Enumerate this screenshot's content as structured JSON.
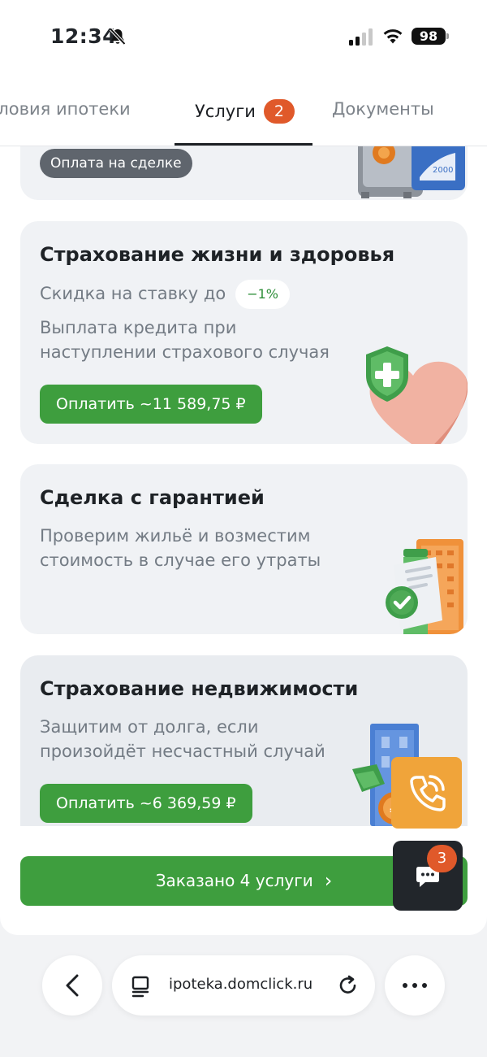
{
  "status_bar": {
    "time": "12:34",
    "battery": "98"
  },
  "tabs": [
    {
      "label": "Условия ипотеки"
    },
    {
      "label": "Услуги",
      "badge": "2"
    },
    {
      "label": "Документы"
    }
  ],
  "cards": {
    "top": {
      "pill": "Оплата на сделке"
    },
    "life": {
      "title": "Страхование жизни и здоровья",
      "discount_label": "Скидка на ставку до",
      "discount_value": "−1%",
      "description": "Выплата кредита при наступлении страхового случая",
      "button": "Оплатить ~11 589,75 ₽"
    },
    "guarantee": {
      "title": "Сделка с гарантией",
      "description": "Проверим жильё и возместим стоимость в случае его утраты"
    },
    "property": {
      "title": "Страхование недвижимости",
      "description": "Защитим от долга, если произойдёт несчастный случай",
      "button": "Оплатить ~6 369,59 ₽"
    }
  },
  "order_button": "Заказано 4 услуги",
  "chat_badge": "3",
  "browser": {
    "url": "ipoteka.domclick.ru"
  },
  "colors": {
    "primary_green": "#3e9e3e",
    "badge_orange": "#e0592a",
    "call_orange": "#f0a43a"
  }
}
